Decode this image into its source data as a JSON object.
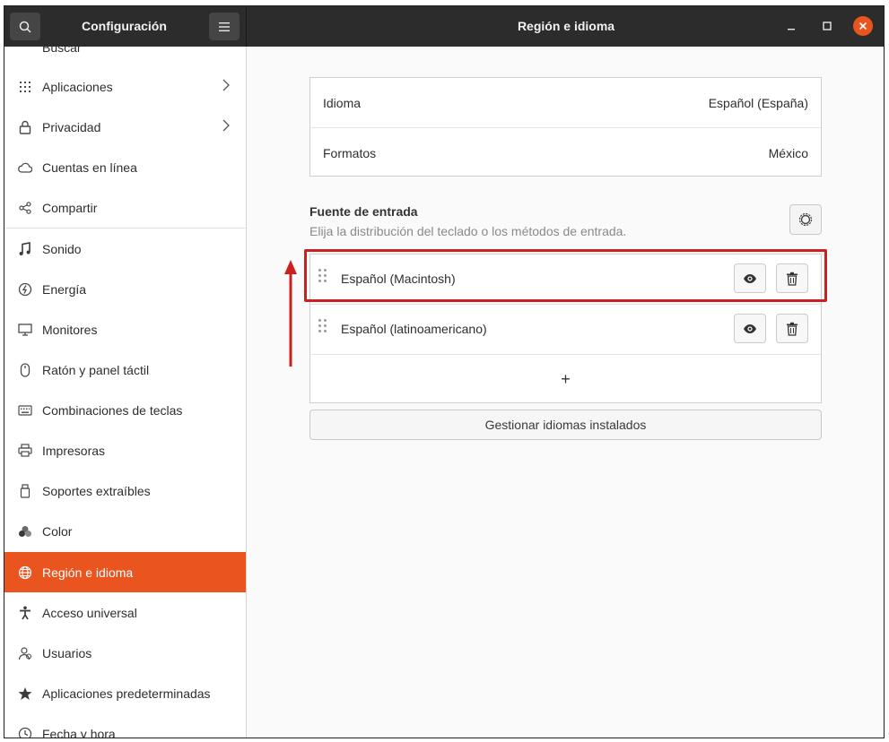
{
  "window": {
    "left_title": "Configuración",
    "right_title": "Región e idioma"
  },
  "sidebar": {
    "items": [
      {
        "label": "Buscar",
        "icon": "search-icon"
      },
      {
        "label": "Aplicaciones",
        "icon": "apps-grid-icon",
        "chevron": true
      },
      {
        "label": "Privacidad",
        "icon": "lock-icon",
        "chevron": true
      },
      {
        "label": "Cuentas en línea",
        "icon": "cloud-icon"
      },
      {
        "label": "Compartir",
        "icon": "share-icon"
      },
      {
        "label": "Sonido",
        "icon": "music-note-icon"
      },
      {
        "label": "Energía",
        "icon": "power-icon"
      },
      {
        "label": "Monitores",
        "icon": "monitor-icon"
      },
      {
        "label": "Ratón y panel táctil",
        "icon": "mouse-icon"
      },
      {
        "label": "Combinaciones de teclas",
        "icon": "keyboard-icon"
      },
      {
        "label": "Impresoras",
        "icon": "printer-icon"
      },
      {
        "label": "Soportes extraíbles",
        "icon": "usb-drive-icon"
      },
      {
        "label": "Color",
        "icon": "color-icon"
      },
      {
        "label": "Región e idioma",
        "icon": "globe-icon",
        "active": true
      },
      {
        "label": "Acceso universal",
        "icon": "accessibility-icon"
      },
      {
        "label": "Usuarios",
        "icon": "users-icon"
      },
      {
        "label": "Aplicaciones predeterminadas",
        "icon": "star-icon"
      },
      {
        "label": "Fecha y hora",
        "icon": "clock-icon"
      }
    ]
  },
  "region": {
    "language_label": "Idioma",
    "language_value": "Español (España)",
    "formats_label": "Formatos",
    "formats_value": "México"
  },
  "input_sources": {
    "title": "Fuente de entrada",
    "subtitle": "Elija la distribución del teclado o los métodos de entrada.",
    "sources": [
      {
        "name": "Español (Macintosh)"
      },
      {
        "name": "Español (latinoamericano)"
      }
    ],
    "add_label": "+"
  },
  "manage_button": "Gestionar idiomas instalados",
  "colors": {
    "accent": "#e9541f",
    "headerbar": "#2c2c2c",
    "annotation": "#cc1f1f"
  }
}
